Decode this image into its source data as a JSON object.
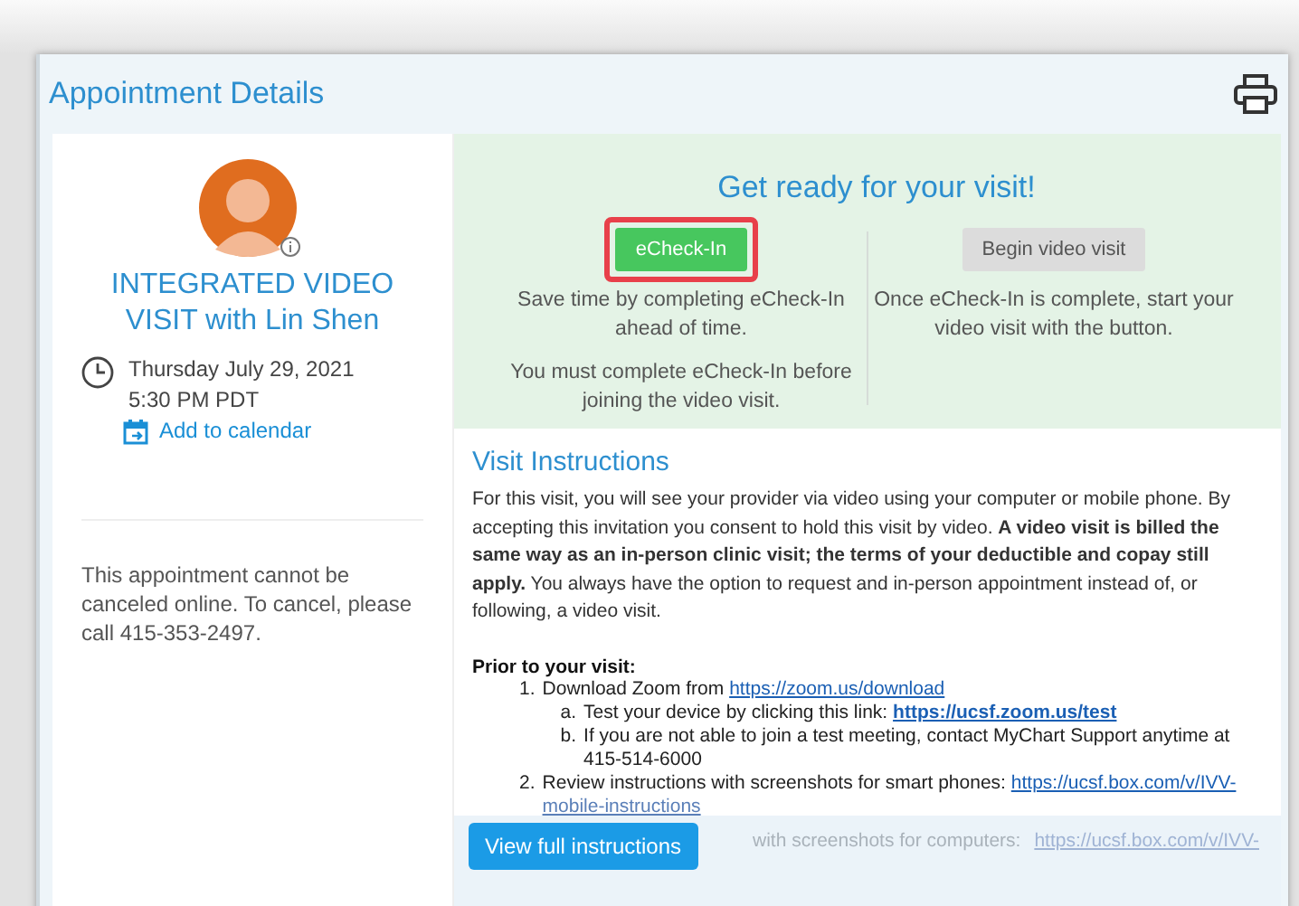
{
  "page_title": "Appointment Details",
  "provider": {
    "title": "INTEGRATED VIDEO VISIT with Lin Shen",
    "date": "Thursday July 29, 2021",
    "time": "5:30 PM PDT",
    "calendar_link": "Add to calendar"
  },
  "cancel_note": "This appointment cannot be canceled online. To cancel, please call 415-353-2497.",
  "checkin": {
    "heading": "Get ready for your visit!",
    "steps": [
      {
        "button": "eCheck-In",
        "highlighted": true,
        "disabled": false,
        "notes": [
          "Save time by completing eCheck-In ahead of time.",
          "You must complete eCheck-In before joining the video visit."
        ]
      },
      {
        "button": "Begin video visit",
        "highlighted": false,
        "disabled": true,
        "notes": [
          "Once eCheck-In is complete, start your video visit with the button."
        ]
      }
    ]
  },
  "instructions": {
    "heading": "Visit Instructions",
    "intro": "For this visit, you will see your provider via video using your computer or mobile phone.  By accepting this invitation you consent to hold this visit by video.  **A video visit is billed the same way as an in-person clinic visit; the terms of your deductible and copay still apply.**  You always have the option to request and in-person appointment instead of, or following, a video visit.",
    "prior_heading": "Prior to your visit:",
    "items": [
      {
        "number": "1.",
        "text": "Download Zoom from",
        "link": "https://zoom.us/download",
        "children": [
          {
            "number": "a.",
            "text": "Test your device by clicking this link:",
            "link": "https://ucsf.zoom.us/test",
            "bold_link": true
          },
          {
            "number": "b.",
            "text": "If you are not able to join a test meeting, contact MyChart Support anytime at 415-514-6000"
          }
        ]
      },
      {
        "number": "2.",
        "text": "Review instructions with screenshots for smart phones:",
        "link": "https://ucsf.box.com/v/IVV-",
        "link_continued": "mobile-instructions"
      }
    ],
    "partial_line": {
      "text": "with screenshots for computers:",
      "link": "https://ucsf.box.com/v/IVV-"
    },
    "more_button": "View full instructions"
  }
}
